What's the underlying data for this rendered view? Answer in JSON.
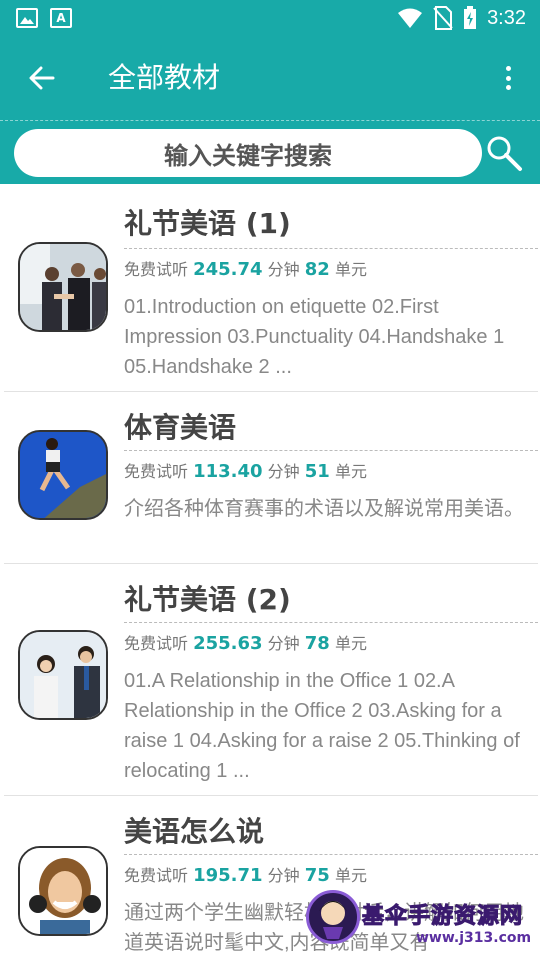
{
  "status_bar": {
    "time": "3:32",
    "left_icons": [
      "image-icon",
      "font-icon"
    ],
    "right_icons": [
      "wifi-icon",
      "no-sim-icon",
      "battery-charging-icon"
    ]
  },
  "app_bar": {
    "title": "全部教材",
    "back_icon": "arrow-left-icon",
    "menu_icon": "more-vert-icon"
  },
  "search": {
    "placeholder": "输入关键字搜索",
    "icon": "search-icon"
  },
  "courses": [
    {
      "title": "礼节美语 (1)",
      "trial_label": "免费试听",
      "minutes": "245.74",
      "minutes_label": "分钟",
      "units": "82",
      "units_label": "单元",
      "description": "01.Introduction on etiquette 02.First Impression 03.Punctuality 04.Handshake 1 05.Handshake 2 ..."
    },
    {
      "title": "体育美语",
      "trial_label": "免费试听",
      "minutes": "113.40",
      "minutes_label": "分钟",
      "units": "51",
      "units_label": "单元",
      "description": "介绍各种体育赛事的术语以及解说常用美语。"
    },
    {
      "title": "礼节美语 (2)",
      "trial_label": "免费试听",
      "minutes": "255.63",
      "minutes_label": "分钟",
      "units": "78",
      "units_label": "单元",
      "description": "01.A Relationship in the Office 1 02.A Relationship in the Office 2 03.Asking for a raise 1 04.Asking for a raise 2 05.Thinking of relocating 1 ..."
    },
    {
      "title": "美语怎么说",
      "trial_label": "免费试听",
      "minutes": "195.71",
      "minutes_label": "分钟",
      "units": "75",
      "units_label": "单元",
      "description": "通过两个学生幽默轻松的对话，讲解如何用地道英语说时髦中文,内容既简单又有"
    }
  ],
  "watermark": {
    "title": "基伞手游资源网",
    "url": "www.j313.com"
  },
  "colors": {
    "primary": "#18aaa8",
    "accent_number": "#1aa3a1",
    "title_text": "#444444",
    "desc_text": "#888888"
  }
}
